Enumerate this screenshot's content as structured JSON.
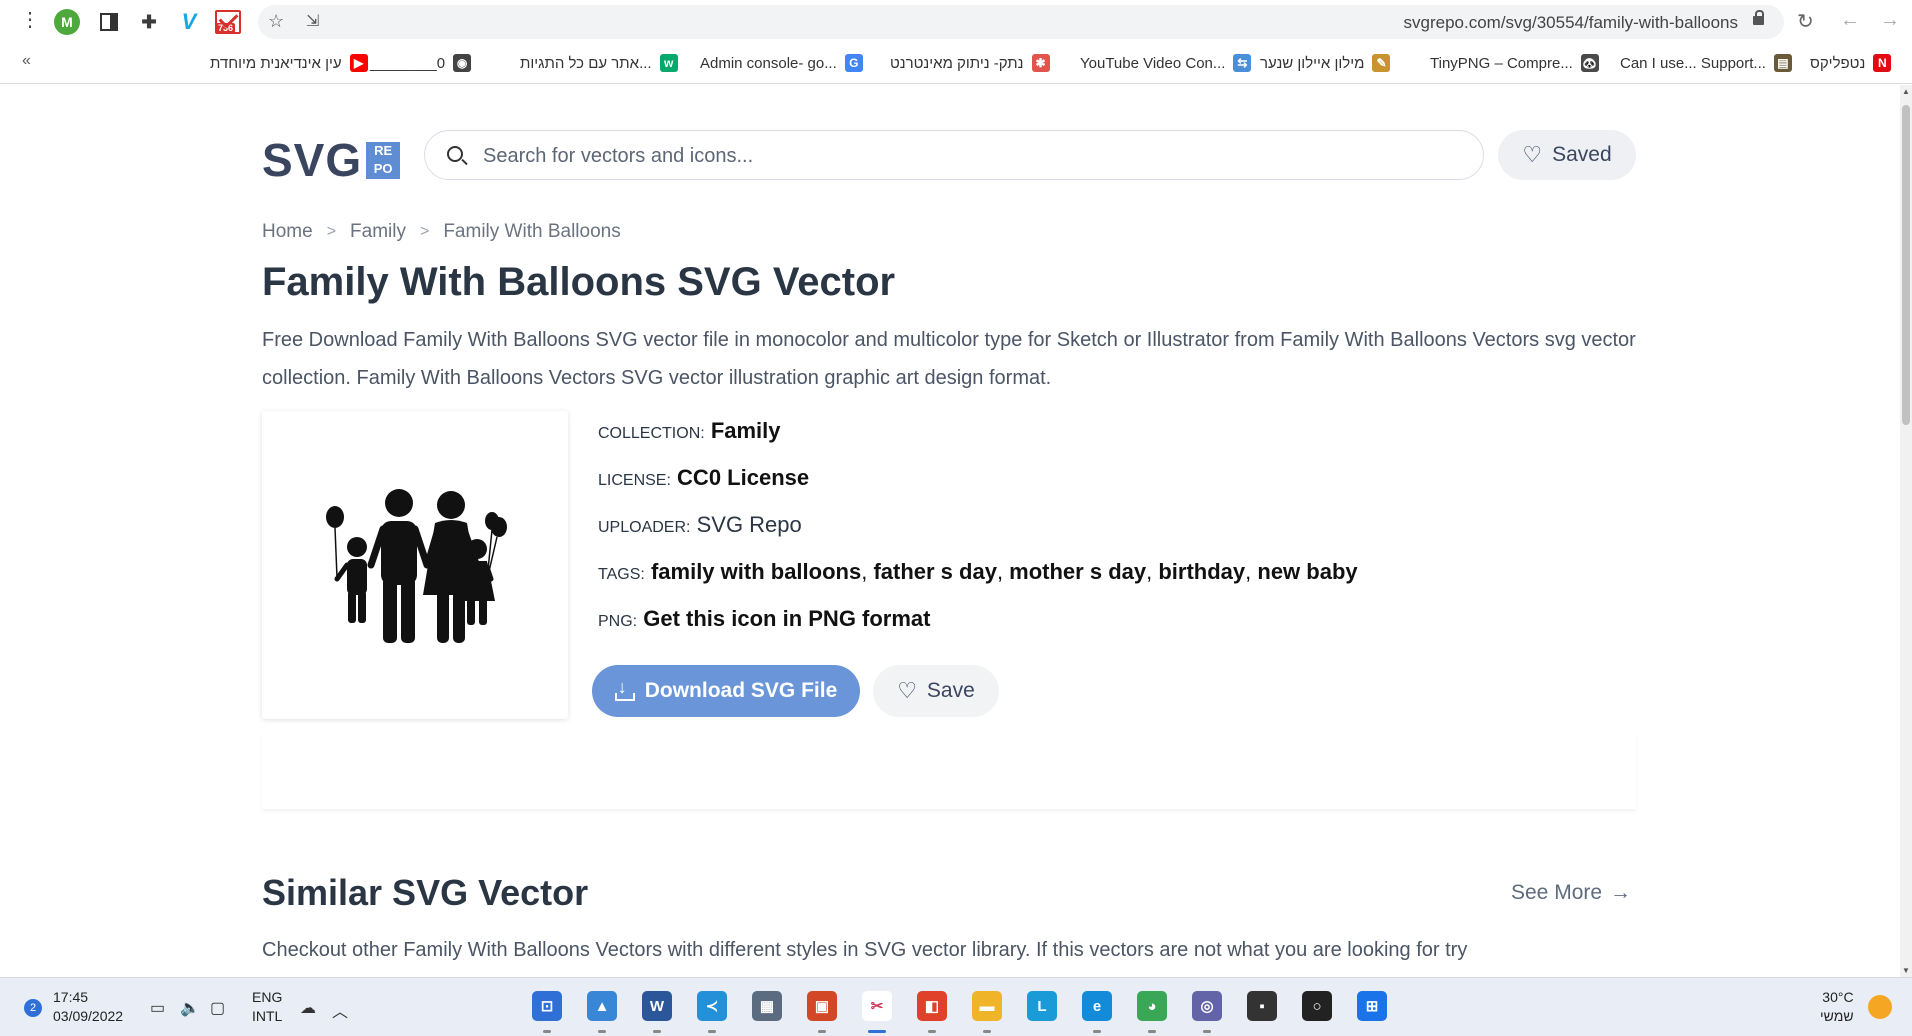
{
  "browser": {
    "url": "svgrepo.com/svg/30554/family-with-balloons",
    "ext_profile_letter": "M",
    "ext_gmail_count": "736",
    "bookmarks_more": "«",
    "bookmarks": [
      {
        "label": "נטפליקס",
        "icon": "netflix-icon",
        "color": "#e50914",
        "glyph": "N"
      },
      {
        "label": "Can I use... Support...",
        "icon": "caniuse-icon",
        "color": "#6b5a3a",
        "glyph": "▤"
      },
      {
        "label": "TinyPNG – Compre...",
        "icon": "tinypng-icon",
        "color": "#4a4a4a",
        "glyph": "🐼"
      },
      {
        "label": "מילון איילון שנער",
        "icon": "dictionary-icon",
        "color": "#c9932f",
        "glyph": "✎"
      },
      {
        "label": "YouTube Video Con...",
        "icon": "converter-icon",
        "color": "#4a8fd8",
        "glyph": "⇆"
      },
      {
        "label": "נתק- ניתוק מאינטרנט",
        "icon": "disconnect-icon",
        "color": "#e2554f",
        "glyph": "✱"
      },
      {
        "label": "Admin console- go...",
        "icon": "google-icon",
        "color": "#4285f4",
        "glyph": "G"
      },
      {
        "label": "אתר עם כל התגיות...",
        "icon": "w3schools-icon",
        "color": "#04aa6d",
        "glyph": "w"
      },
      {
        "label": "________0",
        "icon": "globe-icon",
        "color": "#444444",
        "glyph": "◉"
      },
      {
        "label": "עין אינדיאנית מיוחדת",
        "icon": "youtube-icon",
        "color": "#ff0000",
        "glyph": "▶"
      }
    ]
  },
  "site": {
    "logo_text": "SVG",
    "logo_badge": [
      "RE",
      "PO"
    ],
    "search_placeholder": "Search for vectors and icons...",
    "saved_label": "Saved"
  },
  "breadcrumb": [
    "Home",
    "Family",
    "Family With Balloons"
  ],
  "page": {
    "title": "Family With Balloons SVG Vector",
    "description": "Free Download Family With Balloons SVG vector file in monocolor and multicolor type for Sketch or Illustrator from Family With Balloons Vectors svg vector collection. Family With Balloons Vectors SVG vector illustration graphic art design format."
  },
  "meta": {
    "collection_key": "COLLECTION:",
    "collection_val": "Family",
    "license_key": "LICENSE:",
    "license_val": "CC0 License",
    "uploader_key": "UPLOADER:",
    "uploader_val": "SVG Repo",
    "tags_key": "TAGS:",
    "tags": [
      "family with balloons",
      "father s day",
      "mother s day",
      "birthday",
      "new baby"
    ],
    "png_key": "PNG:",
    "png_val": "Get this icon in PNG format"
  },
  "actions": {
    "download_label": "Download SVG File",
    "save_label": "Save"
  },
  "similar": {
    "title": "Similar SVG Vector",
    "see_more": "See More",
    "description": "Checkout other Family With Balloons Vectors with different styles in SVG vector library. If this vectors are not what you are looking for try"
  },
  "taskbar": {
    "time": "17:45",
    "date": "03/09/2022",
    "notifications": "2",
    "lang_1": "ENG",
    "lang_2": "INTL",
    "temperature": "30°C",
    "weather_day": "שמשי",
    "apps": [
      {
        "name": "remote-desktop-app",
        "color": "#2f6fd6",
        "glyph": "⊡"
      },
      {
        "name": "photos-app",
        "color": "#3a86d6",
        "glyph": "▲"
      },
      {
        "name": "word-app",
        "color": "#2b579a",
        "glyph": "W"
      },
      {
        "name": "vscode-app",
        "color": "#2490d8",
        "glyph": "≺"
      },
      {
        "name": "calculator-app",
        "color": "#5b6b80",
        "glyph": "▦"
      },
      {
        "name": "powerpoint-app",
        "color": "#d24726",
        "glyph": "▣"
      },
      {
        "name": "snipping-tool-app",
        "color": "#cf3a5c",
        "glyph": "✂"
      },
      {
        "name": "office-app",
        "color": "#e0412b",
        "glyph": "◧"
      },
      {
        "name": "file-explorer-app",
        "color": "#f0b429",
        "glyph": "▬"
      },
      {
        "name": "l-app",
        "color": "#1a9bd8",
        "glyph": "L"
      },
      {
        "name": "edge-app",
        "color": "#138bd8",
        "glyph": "e"
      },
      {
        "name": "chrome-app",
        "color": "#3aa757",
        "glyph": "◕"
      },
      {
        "name": "teams-chat-app",
        "color": "#6264a7",
        "glyph": "◎"
      },
      {
        "name": "terminal-app",
        "color": "#333333",
        "glyph": "▪"
      },
      {
        "name": "search-app",
        "color": "#222222",
        "glyph": "○"
      },
      {
        "name": "start-app",
        "color": "#1a73e8",
        "glyph": "⊞"
      }
    ]
  }
}
